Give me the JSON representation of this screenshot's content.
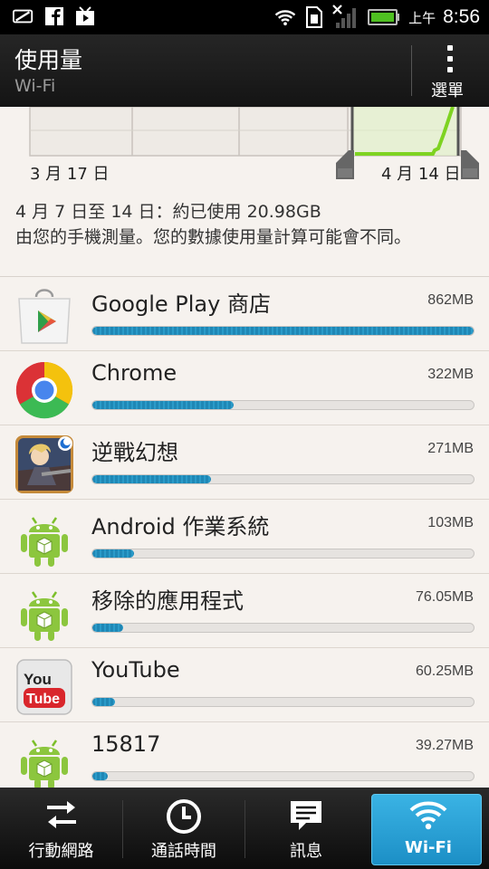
{
  "status_bar": {
    "ampm": "上午",
    "time": "8:56",
    "icons": [
      "signal-off-icon",
      "facebook-icon",
      "youtube-icon",
      "wifi-icon",
      "sim-icon",
      "no-signal-icon",
      "battery-icon"
    ]
  },
  "header": {
    "title": "使用量",
    "subtitle": "Wi-Fi",
    "menu_label": "選單"
  },
  "chart": {
    "start_label": "3 月 17 日",
    "end_label": "4 月 14 日"
  },
  "summary": {
    "line1": "4 月 7 日至 14 日：約已使用 20.98GB",
    "line2": "由您的手機測量。您的數據使用量計算可能會不同。"
  },
  "apps": [
    {
      "name": "Google Play 商店",
      "size": "862MB",
      "usage_fraction": 1.0,
      "icon": "google-play-store-icon"
    },
    {
      "name": "Chrome",
      "size": "322MB",
      "usage_fraction": 0.37,
      "icon": "chrome-icon"
    },
    {
      "name": "逆戰幻想",
      "size": "271MB",
      "usage_fraction": 0.31,
      "icon": "game-icon"
    },
    {
      "name": "Android 作業系統",
      "size": "103MB",
      "usage_fraction": 0.11,
      "icon": "android-icon"
    },
    {
      "name": "移除的應用程式",
      "size": "76.05MB",
      "usage_fraction": 0.08,
      "icon": "android-icon"
    },
    {
      "name": "YouTube",
      "size": "60.25MB",
      "usage_fraction": 0.06,
      "icon": "youtube-app-icon"
    },
    {
      "name": "15817",
      "size": "39.27MB",
      "usage_fraction": 0.04,
      "icon": "android-icon"
    }
  ],
  "tabs": [
    {
      "label": "行動網路",
      "icon": "mobile-data-arrows-icon",
      "active": false
    },
    {
      "label": "通話時間",
      "icon": "clock-icon",
      "active": false
    },
    {
      "label": "訊息",
      "icon": "message-icon",
      "active": false
    },
    {
      "label": "Wi-Fi",
      "icon": "wifi-icon",
      "active": true
    }
  ],
  "colors": {
    "accent": "#2a9bc9",
    "chart_line": "#7ed321",
    "active_tab": "#2ba3d8"
  }
}
